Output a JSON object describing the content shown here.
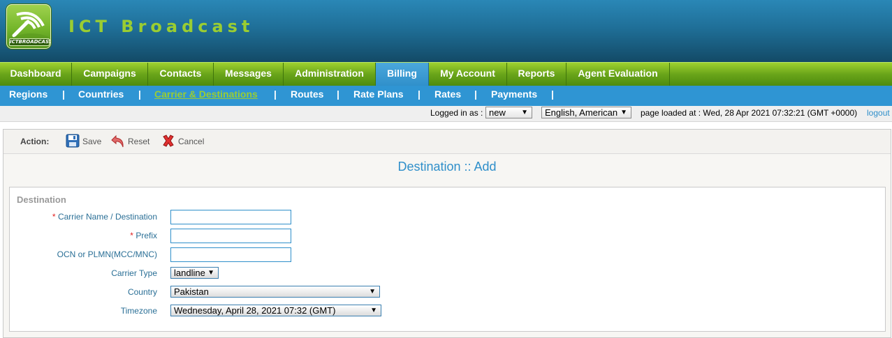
{
  "app": {
    "logo_text": "ICTBROADCAST",
    "title": "ICT Broadcast"
  },
  "main_nav": [
    {
      "label": "Dashboard"
    },
    {
      "label": "Campaigns"
    },
    {
      "label": "Contacts"
    },
    {
      "label": "Messages"
    },
    {
      "label": "Administration"
    },
    {
      "label": "Billing",
      "active": true
    },
    {
      "label": "My Account"
    },
    {
      "label": "Reports"
    },
    {
      "label": "Agent Evaluation"
    }
  ],
  "sub_nav": {
    "items": [
      "Regions",
      "Countries",
      "Carrier & Destinations ",
      "Routes",
      "Rate Plans",
      "Rates",
      "Payments"
    ],
    "separator": "|",
    "active": "Carrier & Destinations "
  },
  "status": {
    "logged_in_label": "Logged in as :",
    "user": "new",
    "language": "English, American",
    "page_loaded": "page loaded at : Wed, 28 Apr 2021 07:32:21 (GMT +0000)",
    "logout": "logout"
  },
  "actions": {
    "label": "Action:",
    "save": "Save",
    "reset": "Reset",
    "cancel": "Cancel"
  },
  "form": {
    "title": "Destination :: Add",
    "legend": "Destination",
    "required_mark": "*",
    "fields": {
      "carrier_name": {
        "label": "Carrier Name / Destination",
        "value": ""
      },
      "prefix": {
        "label": "Prefix",
        "value": ""
      },
      "ocn": {
        "label": "OCN or PLMN(MCC/MNC)",
        "value": ""
      },
      "carrier_type": {
        "label": "Carrier Type",
        "value": "landline"
      },
      "country": {
        "label": "Country",
        "value": "Pakistan"
      },
      "timezone": {
        "label": "Timezone",
        "value": "Wednesday, April 28, 2021 07:32 (GMT)"
      }
    }
  },
  "colors": {
    "header_blue": "#1f6f98",
    "nav_green": "#6aa51a",
    "subnav_blue": "#2f95d3",
    "accent_green": "#9acd32",
    "link_blue": "#2f8fca",
    "required_red": "#e02020"
  }
}
